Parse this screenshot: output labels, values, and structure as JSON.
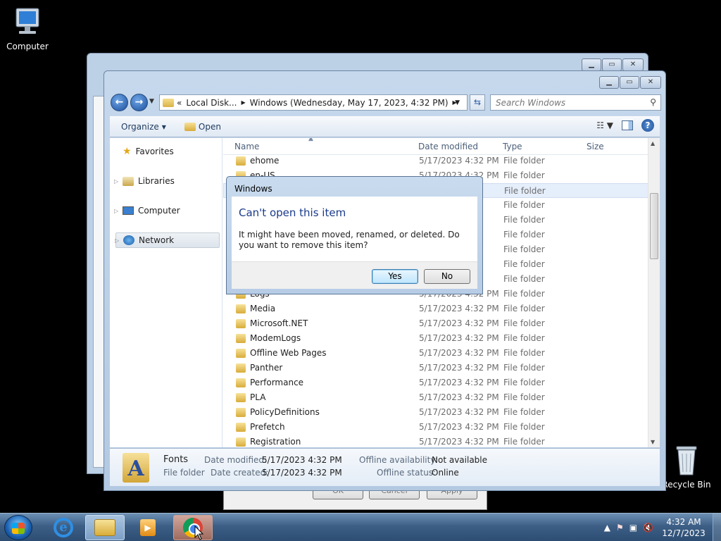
{
  "desktop": {
    "icons": [
      {
        "label": "Computer"
      },
      {
        "label": "Recycle Bin"
      }
    ]
  },
  "background_window": {
    "buttons": [
      "OK",
      "Cancel",
      "Apply"
    ]
  },
  "explorer": {
    "address": {
      "overflow": "«",
      "segments": [
        "Local Disk...",
        "Windows (Wednesday, May 17, 2023, 4:32 PM)"
      ]
    },
    "search_placeholder": "Search Windows",
    "toolbar": {
      "organize": "Organize",
      "open": "Open"
    },
    "nav": {
      "favorites": "Favorites",
      "libraries": "Libraries",
      "computer": "Computer",
      "network": "Network"
    },
    "columns": {
      "name": "Name",
      "date_modified": "Date modified",
      "type": "Type",
      "size": "Size"
    },
    "rows": [
      {
        "name": "ehome",
        "date": "5/17/2023 4:32 PM",
        "type": "File folder"
      },
      {
        "name": "en-US",
        "date": "5/17/2023 4:32 PM",
        "type": "File folder"
      },
      {
        "name": "",
        "date": "",
        "type": "File folder"
      },
      {
        "name": "",
        "date": "",
        "type": "File folder"
      },
      {
        "name": "",
        "date": "",
        "type": "File folder"
      },
      {
        "name": "",
        "date": "",
        "type": "File folder"
      },
      {
        "name": "",
        "date": "",
        "type": "File folder"
      },
      {
        "name": "",
        "date": "",
        "type": "File folder"
      },
      {
        "name": "",
        "date": "",
        "type": "File folder"
      },
      {
        "name": "Logs",
        "date": "5/17/2023 4:32 PM",
        "type": "File folder"
      },
      {
        "name": "Media",
        "date": "5/17/2023 4:32 PM",
        "type": "File folder"
      },
      {
        "name": "Microsoft.NET",
        "date": "5/17/2023 4:32 PM",
        "type": "File folder"
      },
      {
        "name": "ModemLogs",
        "date": "5/17/2023 4:32 PM",
        "type": "File folder"
      },
      {
        "name": "Offline Web Pages",
        "date": "5/17/2023 4:32 PM",
        "type": "File folder"
      },
      {
        "name": "Panther",
        "date": "5/17/2023 4:32 PM",
        "type": "File folder"
      },
      {
        "name": "Performance",
        "date": "5/17/2023 4:32 PM",
        "type": "File folder"
      },
      {
        "name": "PLA",
        "date": "5/17/2023 4:32 PM",
        "type": "File folder"
      },
      {
        "name": "PolicyDefinitions",
        "date": "5/17/2023 4:32 PM",
        "type": "File folder"
      },
      {
        "name": "Prefetch",
        "date": "5/17/2023 4:32 PM",
        "type": "File folder"
      },
      {
        "name": "Registration",
        "date": "5/17/2023 4:32 PM",
        "type": "File folder"
      }
    ],
    "details": {
      "name": "Fonts",
      "kind": "File folder",
      "date_modified_label": "Date modified:",
      "date_modified": "5/17/2023 4:32 PM",
      "date_created_label": "Date created:",
      "date_created": "5/17/2023 4:32 PM",
      "offline_availability_label": "Offline availability:",
      "offline_availability": "Not available",
      "offline_status_label": "Offline status:",
      "offline_status": "Online"
    }
  },
  "dialog": {
    "title": "Windows",
    "heading": "Can't open this item",
    "message": "It might have been moved, renamed, or deleted. Do you want to remove this item?",
    "yes": "Yes",
    "no": "No"
  },
  "taskbar": {
    "time": "4:32 AM",
    "date": "12/7/2023"
  }
}
